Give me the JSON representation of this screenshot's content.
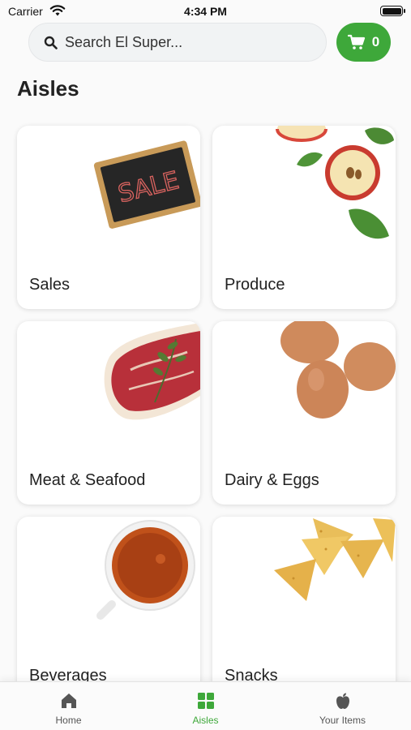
{
  "status_bar": {
    "carrier": "Carrier",
    "time": "4:34 PM"
  },
  "search": {
    "placeholder": "Search El Super..."
  },
  "cart": {
    "count": "0",
    "icon": "cart-icon"
  },
  "page": {
    "title": "Aisles"
  },
  "aisles": [
    {
      "label": "Sales",
      "image": "sale-chalkboard"
    },
    {
      "label": "Produce",
      "image": "apples"
    },
    {
      "label": "Meat & Seafood",
      "image": "steak"
    },
    {
      "label": "Dairy & Eggs",
      "image": "eggs"
    },
    {
      "label": "Beverages",
      "image": "tea-cup"
    },
    {
      "label": "Snacks",
      "image": "tortilla-chips"
    }
  ],
  "sale_sign_text": "SALE",
  "tabs": [
    {
      "label": "Home",
      "icon": "home-icon",
      "active": false
    },
    {
      "label": "Aisles",
      "icon": "grid-icon",
      "active": true
    },
    {
      "label": "Your Items",
      "icon": "apple-icon",
      "active": false
    }
  ],
  "colors": {
    "accent": "#3ea83a",
    "inactive": "#555555"
  }
}
